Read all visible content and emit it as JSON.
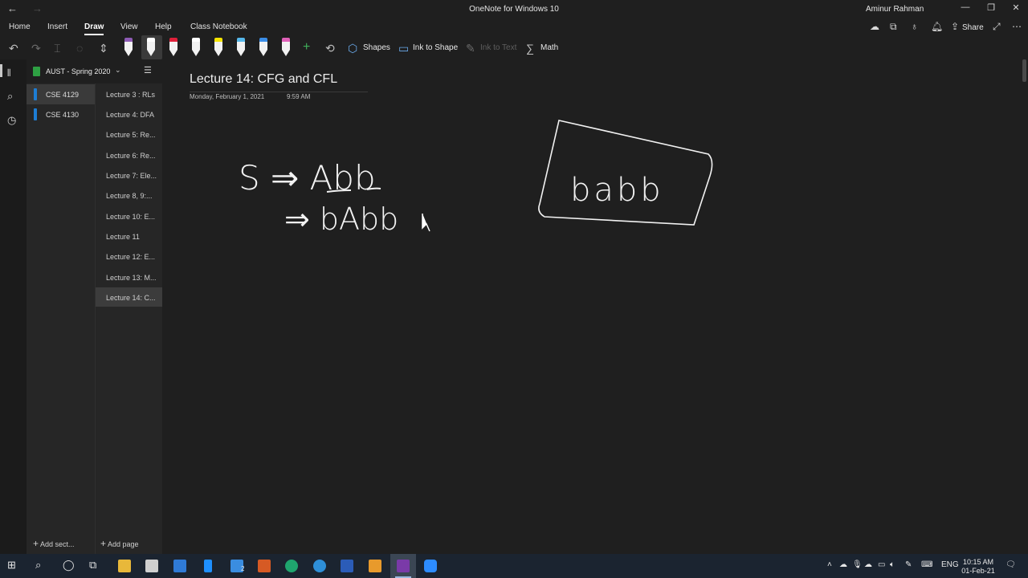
{
  "window": {
    "title": "OneNote for Windows 10",
    "user": "Aminur Rahman",
    "back_glyph": "←",
    "forward_glyph": "→"
  },
  "menu": {
    "tabs": [
      "Home",
      "Insert",
      "Draw",
      "View",
      "Help",
      "Class Notebook"
    ],
    "active_tab": "Draw",
    "share_label": "Share"
  },
  "toolbar": {
    "shapes_label": "Shapes",
    "ink_to_shape_label": "Ink to Shape",
    "ink_to_text_label": "Ink to Text",
    "math_label": "Math",
    "pen_colors": [
      "#8e5bb5",
      "#ffffff",
      "#e0203a",
      "#ffffff",
      "#f5e400",
      "#56b8ea",
      "#3b8ee8",
      "#e060b8"
    ]
  },
  "notebook": {
    "name": "AUST - Spring 2020",
    "color": "#2ea043"
  },
  "sections": {
    "items": [
      "CSE 4129",
      "CSE 4130"
    ],
    "selected": "CSE 4129",
    "add_label": "Add sect..."
  },
  "pages": {
    "items": [
      "Lecture 3 : RLs",
      "Lecture 4: DFA",
      "Lecture 5: Re...",
      "Lecture 6: Re...",
      "Lecture 7: Ele...",
      "Lecture 8, 9:...",
      "Lecture 10: E...",
      "Lecture 11",
      "Lecture 12: E...",
      "Lecture 13: M...",
      "Lecture 14: C..."
    ],
    "selected": "Lecture 14: C...",
    "add_label": "Add page"
  },
  "page": {
    "title": "Lecture 14: CFG and CFL",
    "date": "Monday, February 1, 2021",
    "time": "9:59 AM",
    "ink_lines": [
      "S ⇒ Abb",
      "⇒ bAbb"
    ],
    "ink_boxed": "babb"
  },
  "taskbar": {
    "clock_time": "10:15 AM",
    "clock_date": "01-Feb-21",
    "lang": "ENG",
    "badge_count": "2"
  }
}
